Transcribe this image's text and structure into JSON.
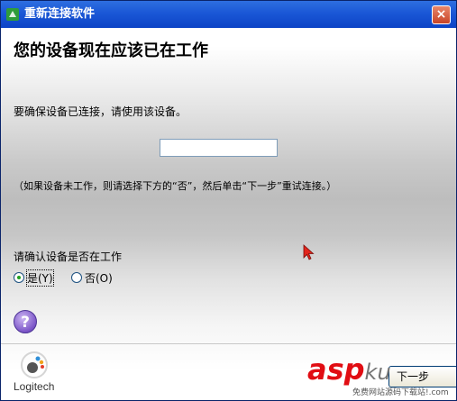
{
  "window": {
    "title": "重新连接软件",
    "close_label": "×"
  },
  "page": {
    "heading": "您的设备现在应该已在工作",
    "instruction": "要确保设备已连接，请使用该设备。",
    "input_value": "",
    "note": "（如果设备未工作，则请选择下方的“否”，然后单击“下一步”重试连接。）",
    "question": "请确认设备是否在工作",
    "options": [
      {
        "label": "是(Y)",
        "selected": true
      },
      {
        "label": "否(O)",
        "selected": false
      }
    ],
    "help_glyph": "?"
  },
  "footer": {
    "logo_text": "Logitech",
    "next_button_partial": "下一步"
  },
  "watermark": {
    "main": "asp",
    "suffix": "ku",
    "sub": "免费网站源码下载站!",
    "sub_domain": ".com"
  },
  "colors": {
    "titlebar": "#0c43c6",
    "close": "#c84427",
    "watermark_red": "#e10d13"
  },
  "icons": [
    "app-icon",
    "close-icon",
    "help-icon",
    "logitech-logo-icon",
    "mouse-cursor-icon"
  ]
}
